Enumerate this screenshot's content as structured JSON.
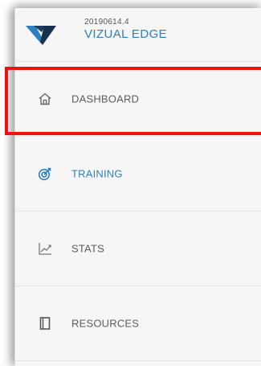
{
  "brand": {
    "version": "20190614.4",
    "name": "VIZUAL EDGE",
    "logo_icon": "vizual-edge-logo",
    "accent_color": "#2d7fbf"
  },
  "nav": {
    "items": [
      {
        "label": "DASHBOARD",
        "icon": "home-icon",
        "active": false
      },
      {
        "label": "TRAINING",
        "icon": "target-icon",
        "active": true
      },
      {
        "label": "STATS",
        "icon": "chart-line-icon",
        "active": false
      },
      {
        "label": "RESOURCES",
        "icon": "book-icon",
        "active": false
      }
    ]
  },
  "annotation": {
    "highlight_color": "#ee1111",
    "highlighted_item": "DASHBOARD"
  }
}
